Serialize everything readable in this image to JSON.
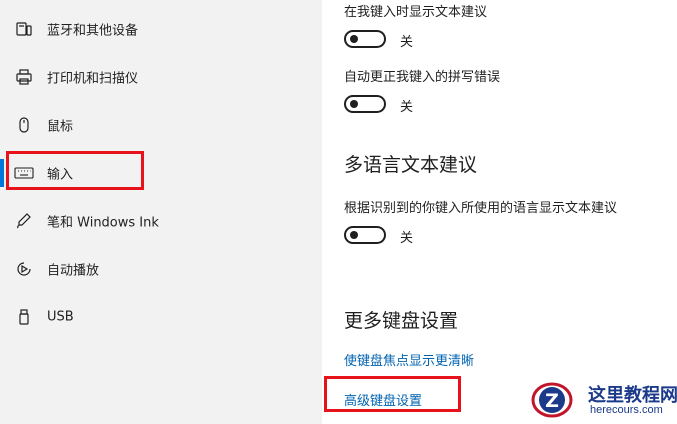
{
  "sidebar": {
    "items": [
      {
        "label": "蓝牙和其他设备",
        "icon": "bluetooth-devices-icon"
      },
      {
        "label": "打印机和扫描仪",
        "icon": "printer-icon"
      },
      {
        "label": "鼠标",
        "icon": "mouse-icon"
      },
      {
        "label": "输入",
        "icon": "keyboard-icon",
        "active": true
      },
      {
        "label": "笔和 Windows Ink",
        "icon": "pen-icon"
      },
      {
        "label": "自动播放",
        "icon": "autoplay-icon"
      },
      {
        "label": "USB",
        "icon": "usb-icon"
      }
    ]
  },
  "settings": {
    "show_suggestions_label": "在我键入时显示文本建议",
    "show_suggestions_state": "关",
    "autocorrect_label": "自动更正我键入的拼写错误",
    "autocorrect_state": "关"
  },
  "multilingual": {
    "heading": "多语言文本建议",
    "label": "根据识别到的你键入所使用的语言显示文本建议",
    "state": "关"
  },
  "more_keyboard": {
    "heading": "更多键盘设置",
    "links": [
      "使键盘焦点显示更清晰",
      "高级键盘设置"
    ]
  },
  "watermark": {
    "title": "这里教程网",
    "url": "herecours.com",
    "logo_letter": "Z"
  },
  "colors": {
    "accent": "#0078d7",
    "link": "#0063b1",
    "highlight": "#e8121b",
    "sidebar_bg": "#f2f2f2"
  }
}
